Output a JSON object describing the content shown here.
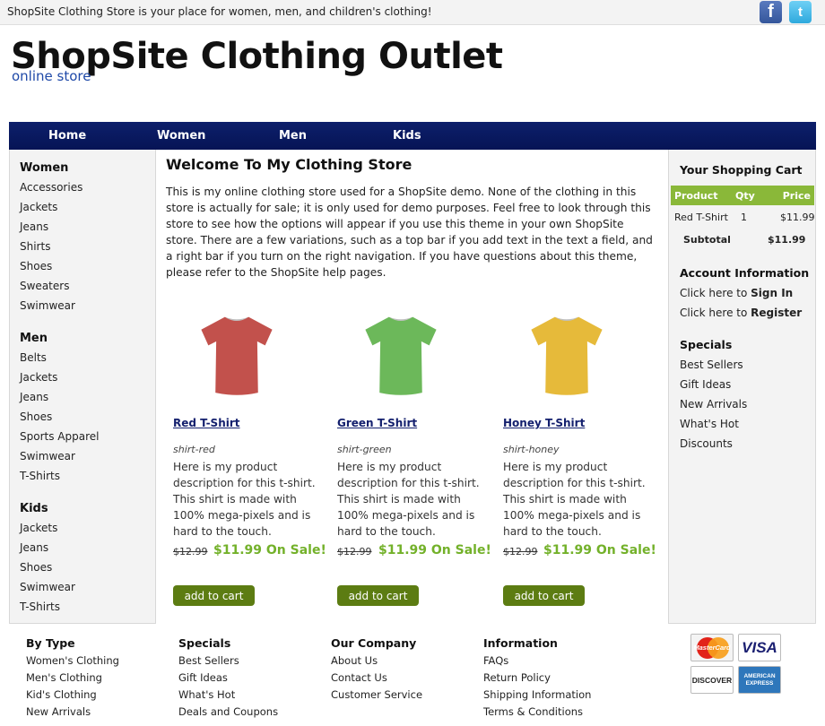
{
  "topbar": {
    "text": "ShopSite Clothing Store is your place for women, men, and children's clothing!"
  },
  "header": {
    "title": "ShopSite Clothing Outlet",
    "subtitle": "online store"
  },
  "nav": [
    "Home",
    "Women",
    "Men",
    "Kids"
  ],
  "left_nav": {
    "women": {
      "title": "Women",
      "items": [
        "Accessories",
        "Jackets",
        "Jeans",
        "Shirts",
        "Shoes",
        "Sweaters",
        "Swimwear"
      ]
    },
    "men": {
      "title": "Men",
      "items": [
        "Belts",
        "Jackets",
        "Jeans",
        "Shoes",
        "Sports Apparel",
        "Swimwear",
        "T-Shirts"
      ]
    },
    "kids": {
      "title": "Kids",
      "items": [
        "Jackets",
        "Jeans",
        "Shoes",
        "Swimwear",
        "T-Shirts"
      ]
    }
  },
  "main": {
    "title": "Welcome To My Clothing Store",
    "intro": "This is my online clothing store used for a ShopSite demo. None of the clothing in this store is actually for sale; it is only used for demo purposes. Feel free to look through this store to see how the options will appear if you use this theme in your own ShopSite store. There are a few variations, such as a top bar if you add text in the text a field, and a right bar if you turn on the right navigation. If you have questions about this theme, please refer to the ShopSite help pages."
  },
  "products": [
    {
      "name": "Red T-Shirt",
      "sku": "shirt-red",
      "description": "Here is my product description for this t-shirt. This shirt is made with 100% mega-pixels and is hard to the touch.",
      "old_price": "$12.99",
      "sale_price": "$11.99 On Sale!",
      "button": "add to cart",
      "color": "#c2514c"
    },
    {
      "name": "Green T-Shirt",
      "sku": "shirt-green",
      "description": "Here is my product description for this t-shirt. This shirt is made with 100% mega-pixels and is hard to the touch.",
      "old_price": "$12.99",
      "sale_price": "$11.99 On Sale!",
      "button": "add to cart",
      "color": "#6cb85a"
    },
    {
      "name": "Honey T-Shirt",
      "sku": "shirt-honey",
      "description": "Here is my product description for this t-shirt. This shirt is made with 100% mega-pixels and is hard to the touch.",
      "old_price": "$12.99",
      "sale_price": "$11.99 On Sale!",
      "button": "add to cart",
      "color": "#e6ba3a"
    }
  ],
  "cart": {
    "title": "Your Shopping Cart",
    "headers": {
      "product": "Product",
      "qty": "Qty",
      "price": "Price"
    },
    "row": {
      "product": "Red T-Shirt",
      "qty": "1",
      "price": "$11.99"
    },
    "subtotal_label": "Subtotal",
    "subtotal": "$11.99"
  },
  "account": {
    "title": "Account Information",
    "click_here": "Click here to",
    "sign_in": "Sign In",
    "register": "Register"
  },
  "specials": {
    "title": "Specials",
    "items": [
      "Best Sellers",
      "Gift Ideas",
      "New Arrivals",
      "What's Hot",
      "Discounts"
    ]
  },
  "footer": [
    {
      "title": "By Type",
      "items": [
        "Women's Clothing",
        "Men's Clothing",
        "Kid's Clothing",
        "New Arrivals"
      ]
    },
    {
      "title": "Specials",
      "items": [
        "Best Sellers",
        "Gift Ideas",
        "What's Hot",
        "Deals and Coupons"
      ]
    },
    {
      "title": "Our Company",
      "items": [
        "About Us",
        "Contact Us",
        "Customer Service"
      ]
    },
    {
      "title": "Information",
      "items": [
        "FAQs",
        "Return Policy",
        "Shipping Information",
        "Terms & Conditions"
      ]
    }
  ],
  "cards": {
    "mastercard": "MasterCard",
    "visa": "VISA",
    "discover": "DISCOVER",
    "amex_top": "AMERICAN",
    "amex_bottom": "EXPRESS"
  },
  "social": {
    "facebook": "f",
    "twitter": "t"
  },
  "colors": {
    "nav": "#061455",
    "sale": "#73b12a",
    "button": "#5c7c12",
    "cart_header": "#8ab839",
    "link": "#14206e"
  }
}
